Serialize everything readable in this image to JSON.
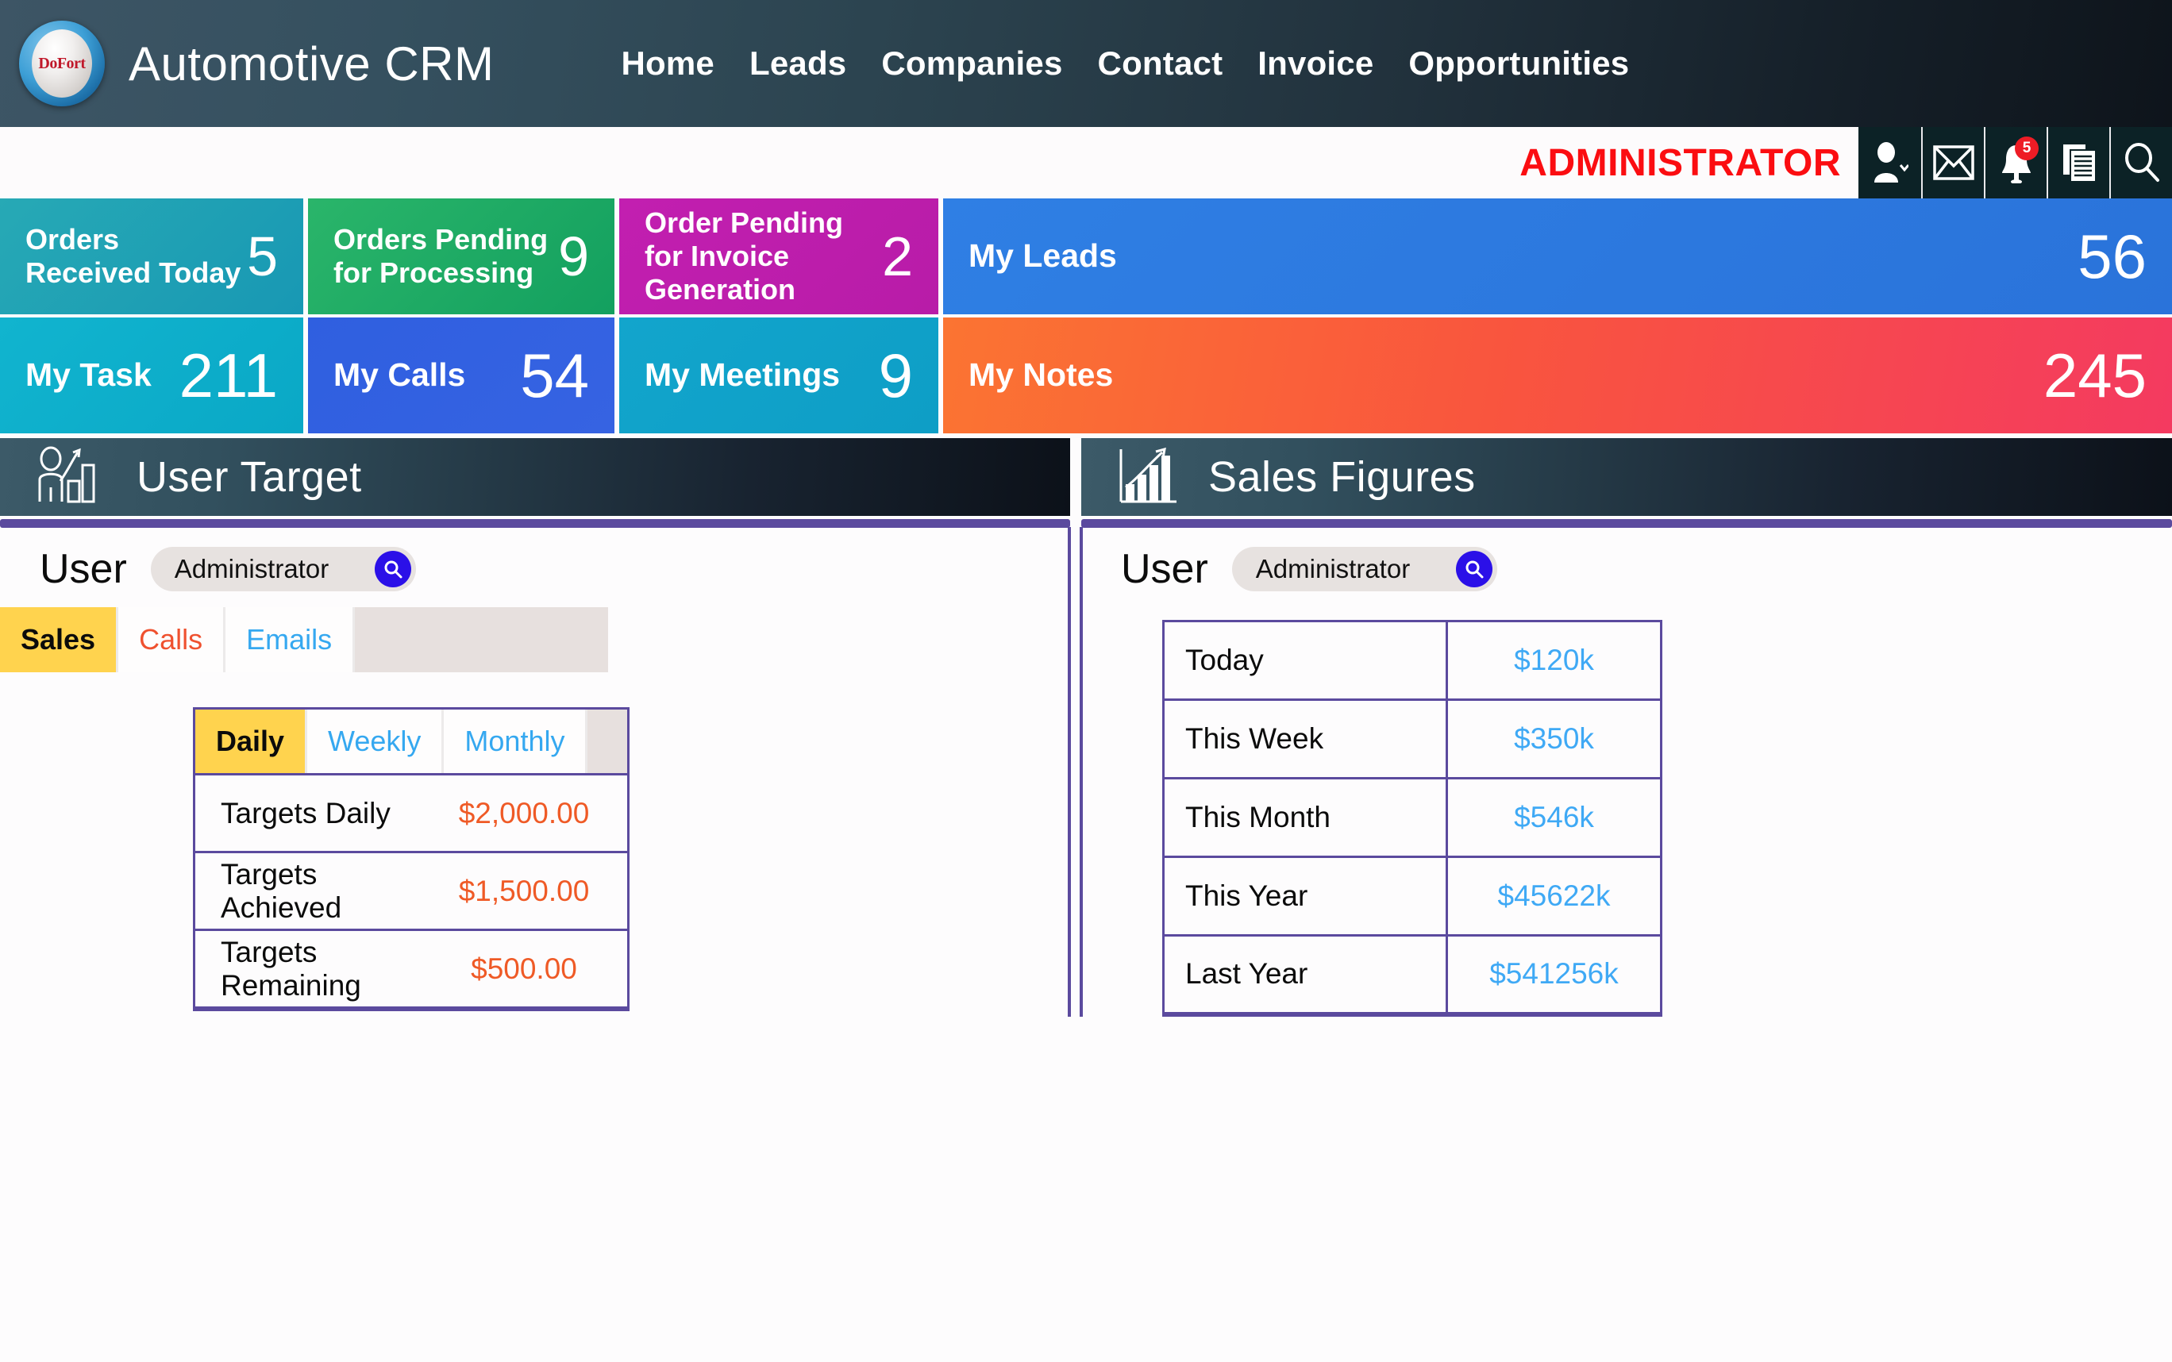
{
  "brand": {
    "logo_text": "DoFort",
    "title": "Automotive  CRM"
  },
  "nav": {
    "items": [
      {
        "label": "Home"
      },
      {
        "label": "Leads"
      },
      {
        "label": "Companies"
      },
      {
        "label": "Contact"
      },
      {
        "label": "Invoice"
      },
      {
        "label": "Opportunities"
      }
    ]
  },
  "adminbar": {
    "role_label": "ADMINISTRATOR",
    "icons": [
      {
        "name": "user-account-icon"
      },
      {
        "name": "envelope-icon"
      },
      {
        "name": "bell-notification-icon",
        "badge": "5"
      },
      {
        "name": "documents-icon"
      },
      {
        "name": "search-icon"
      }
    ],
    "notification_count": "5"
  },
  "kpis": [
    {
      "label": "Orders Received Today",
      "value": "5"
    },
    {
      "label": "Orders Pending for Processing",
      "value": "9"
    },
    {
      "label": "Order Pending for Invoice Generation",
      "value": "2"
    },
    {
      "label": "My Leads",
      "value": "56"
    },
    {
      "label": "My Task",
      "value": "211"
    },
    {
      "label": "My Calls",
      "value": "54"
    },
    {
      "label": "My Meetings",
      "value": "9"
    },
    {
      "label": "My Notes",
      "value": "245"
    }
  ],
  "user_target": {
    "panel_title": "User Target",
    "user_label": "User",
    "user_value": "Administrator",
    "tabs": [
      {
        "label": "Sales",
        "active": true
      },
      {
        "label": "Calls",
        "active": false
      },
      {
        "label": "Emails",
        "active": false
      }
    ],
    "subtabs": [
      {
        "label": "Daily",
        "active": true
      },
      {
        "label": "Weekly",
        "active": false
      },
      {
        "label": "Monthly",
        "active": false
      }
    ],
    "rows": [
      {
        "key": "Targets Daily",
        "value": "$2,000.00"
      },
      {
        "key": "Targets Achieved",
        "value": "$1,500.00"
      },
      {
        "key": "Targets Remaining",
        "value": "$500.00"
      }
    ]
  },
  "sales_figures": {
    "panel_title": "Sales Figures",
    "user_label": "User",
    "user_value": "Administrator",
    "rows": [
      {
        "key": "Today",
        "value": "$120k"
      },
      {
        "key": "This Week",
        "value": "$350k"
      },
      {
        "key": "This Month",
        "value": "$546k"
      },
      {
        "key": "This Year",
        "value": "$45622k"
      },
      {
        "key": "Last Year",
        "value": "$541256k"
      }
    ]
  },
  "colors": {
    "accent_purple": "#5b4a9e",
    "admin_red": "#fb0d11",
    "tab_active": "#ffd34e",
    "target_value": "#ef5a26",
    "sales_value": "#3fa9f5",
    "search_blue": "#2b10e8"
  }
}
